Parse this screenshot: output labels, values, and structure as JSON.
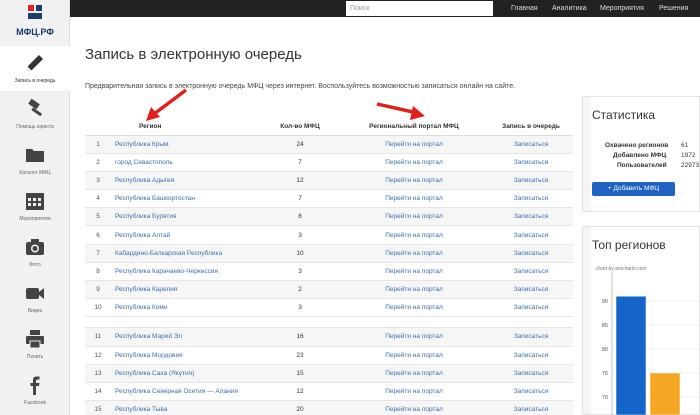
{
  "topbar": {
    "search_placeholder": "Поиск",
    "nav": [
      "Главная",
      "Аналитика",
      "Мероприятия",
      "Решения"
    ]
  },
  "logo": {
    "text": "МФЦ.РФ"
  },
  "sidebar": {
    "items": [
      {
        "label": "Запись в очередь",
        "icon": "pencil-icon",
        "active": true
      },
      {
        "label": "Помощь юриста",
        "icon": "gavel-icon",
        "active": false
      },
      {
        "label": "Каталог МФЦ",
        "icon": "folder-icon",
        "active": false
      },
      {
        "label": "Мероприятия",
        "icon": "calendar-icon",
        "active": false
      },
      {
        "label": "Фото",
        "icon": "camera-icon",
        "active": false
      },
      {
        "label": "Видео",
        "icon": "video-camera-icon",
        "active": false
      },
      {
        "label": "Печать",
        "icon": "printer-icon",
        "active": false
      },
      {
        "label": "Facebook",
        "icon": "facebook-icon",
        "active": false
      }
    ]
  },
  "main": {
    "title": "Запись в электронную очередь",
    "intro": "Предварительная запись в электронную очередь МФЦ через интернет. Воспользуйтесь возможностью записаться онлайн на сайте."
  },
  "table": {
    "headers": {
      "region": "Регион",
      "count": "Кол-во МФЦ",
      "portal": "Региональный портал МФЦ",
      "queue": "Запись в очередь"
    },
    "rows": [
      {
        "num": "1",
        "region": "Республика Крым",
        "count": "24",
        "portal": "Перейти на портал",
        "queue": "Записаться"
      },
      {
        "num": "2",
        "region": "город Севастополь",
        "count": "7",
        "portal": "Перейти на портал",
        "queue": "Записаться"
      },
      {
        "num": "3",
        "region": "Республика Адыгея",
        "count": "12",
        "portal": "Перейти на портал",
        "queue": "Записаться"
      },
      {
        "num": "4",
        "region": "Республика Башкортостан",
        "count": "7",
        "portal": "Перейти на портал",
        "queue": "Записаться"
      },
      {
        "num": "5",
        "region": "Республика Бурятия",
        "count": "6",
        "portal": "Перейти на портал",
        "queue": "Записаться"
      },
      {
        "num": "6",
        "region": "Республика Алтай",
        "count": "3",
        "portal": "Перейти на портал",
        "queue": "Записаться"
      },
      {
        "num": "7",
        "region": "Кабардино-Балкарская Республика",
        "count": "10",
        "portal": "Перейти на портал",
        "queue": "Записаться"
      },
      {
        "num": "8",
        "region": "Республика Карачаево-Черкессия",
        "count": "3",
        "portal": "Перейти на портал",
        "queue": "Записаться"
      },
      {
        "num": "9",
        "region": "Республика Карелия",
        "count": "2",
        "portal": "Перейти на портал",
        "queue": "Записаться"
      },
      {
        "num": "10",
        "region": "Республика Коми",
        "count": "3",
        "portal": "Перейти на портал",
        "queue": "Записаться"
      },
      {
        "num": "11",
        "region": "Республика Марий Эл",
        "count": "16",
        "portal": "Перейти на портал",
        "queue": "Записаться"
      },
      {
        "num": "12",
        "region": "Республика Мордовия",
        "count": "23",
        "portal": "Перейти на портал",
        "queue": "Записаться"
      },
      {
        "num": "13",
        "region": "Республика Саха (Якутия)",
        "count": "15",
        "portal": "Перейти на портал",
        "queue": "Записаться"
      },
      {
        "num": "14",
        "region": "Республика Северная Осетия — Алания",
        "count": "12",
        "portal": "Перейти на портал",
        "queue": "Записаться"
      },
      {
        "num": "15",
        "region": "Республика Тыва",
        "count": "20",
        "portal": "Перейти на портал",
        "queue": "Записаться"
      }
    ]
  },
  "stats": {
    "title": "Статистика",
    "rows": [
      {
        "label": "Охвачено регионов",
        "value": "61"
      },
      {
        "label": "Добавлено МФЦ",
        "value": "1972"
      },
      {
        "label": "Пользователей",
        "value": "22973"
      }
    ],
    "add_button": "+ Добавить МФЦ"
  },
  "top_regions": {
    "title": "Топ регионов",
    "credit": "chart by amcharts.com"
  },
  "chart_data": {
    "type": "bar",
    "ylim": [
      65,
      90
    ],
    "y_ticks": [
      "90",
      "85",
      "80",
      "75",
      "70",
      "65"
    ],
    "series": [
      {
        "values": [
          91
        ],
        "color": "#1565c8"
      },
      {
        "values": [
          75
        ],
        "color": "#f5a623"
      }
    ]
  },
  "colors": {
    "accent": "#1e63c4",
    "link": "#3a6fb0",
    "arrow": "#e0201b",
    "topbar": "#222222"
  }
}
